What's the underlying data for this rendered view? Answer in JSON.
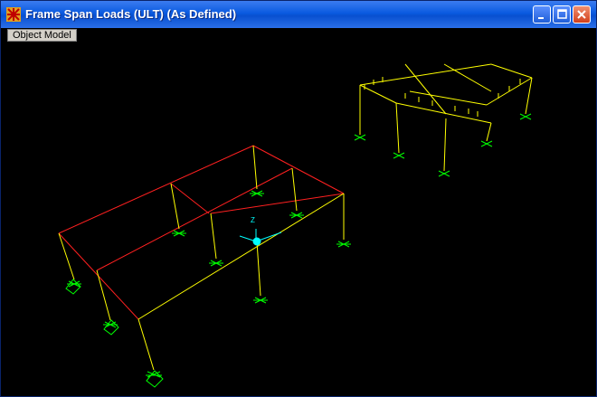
{
  "window": {
    "title": "Frame Span Loads (ULT) (As Defined)",
    "title_bar_color": "#0a5ae0",
    "buttons": [
      "minimize-icon",
      "maximize-icon",
      "close-icon"
    ]
  },
  "viewport": {
    "tab_label": "Object Model",
    "background": "#000000",
    "axis_label": "Z",
    "colors": {
      "frame": "#ffff00",
      "loaded_beam": "#ff0000",
      "support": "#00ff00",
      "axes": "#00ffff"
    }
  }
}
